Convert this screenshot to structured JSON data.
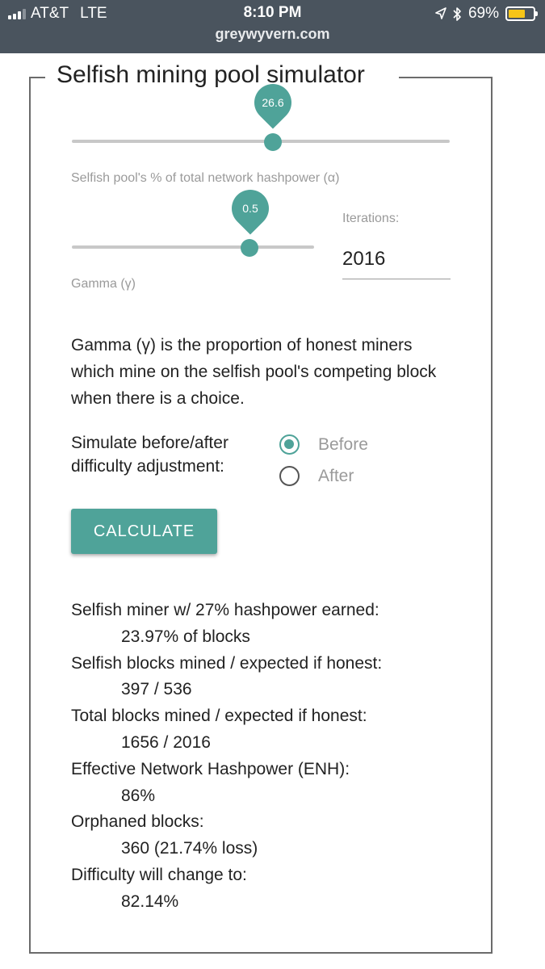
{
  "status_bar": {
    "carrier": "AT&T",
    "network": "LTE",
    "time": "8:10 PM",
    "url": "greywyvern.com",
    "battery_percent": "69%",
    "battery_level": 0.69,
    "icons": [
      "signal-icon",
      "location-arrow-icon",
      "bluetooth-icon",
      "battery-icon"
    ]
  },
  "simulator": {
    "title": "Selfish mining pool simulator",
    "alpha_slider": {
      "value_label": "26.6",
      "value": 26.6,
      "min": 0,
      "max": 50,
      "caption": "Selfish pool's % of total network hashpower (α)"
    },
    "gamma_slider": {
      "value_label": "0.5",
      "value": 0.5,
      "min": 0,
      "max": 1,
      "caption": "Gamma (γ)"
    },
    "iterations": {
      "label": "Iterations:",
      "value": "2016"
    },
    "description": "Gamma (γ) is the proportion of honest miners which mine on the selfish pool's competing block when there is a choice.",
    "simulate_label": "Simulate before/after difficulty adjustment:",
    "radio_options": [
      {
        "label": "Before",
        "checked": true
      },
      {
        "label": "After",
        "checked": false
      }
    ],
    "calculate_label": "CALCULATE",
    "accent_color": "#4fa399"
  },
  "results": [
    {
      "label": "Selfish miner w/ 27% hashpower earned:",
      "value": "23.97% of blocks"
    },
    {
      "label": "Selfish blocks mined / expected if honest:",
      "value": "397 / 536"
    },
    {
      "label": "Total blocks mined / expected if honest:",
      "value": "1656 / 2016"
    },
    {
      "label": "Effective Network Hashpower (ENH):",
      "value": "86%"
    },
    {
      "label": "Orphaned blocks:",
      "value": "360 (21.74% loss)"
    },
    {
      "label": "Difficulty will change to:",
      "value": "82.14%"
    }
  ]
}
